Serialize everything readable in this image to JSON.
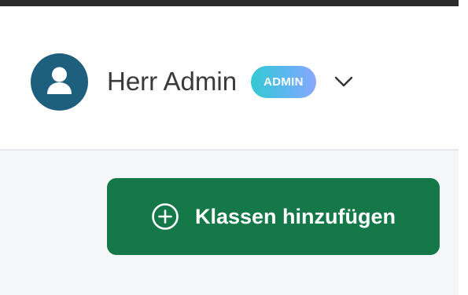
{
  "header": {
    "user": {
      "avatar_icon": "user-icon",
      "name": "Herr Admin",
      "role_badge": "ADMIN",
      "dropdown_icon": "chevron-down-icon"
    }
  },
  "main": {
    "add_class_button": {
      "icon": "plus-circle-icon",
      "label": "Klassen hinzufügen"
    }
  },
  "colors": {
    "avatar_bg": "#1e5f7e",
    "badge_gradient_start": "#34c9d3",
    "badge_gradient_end": "#8aa6ff",
    "primary_button": "#147849",
    "page_bg": "#f5f6f8"
  }
}
